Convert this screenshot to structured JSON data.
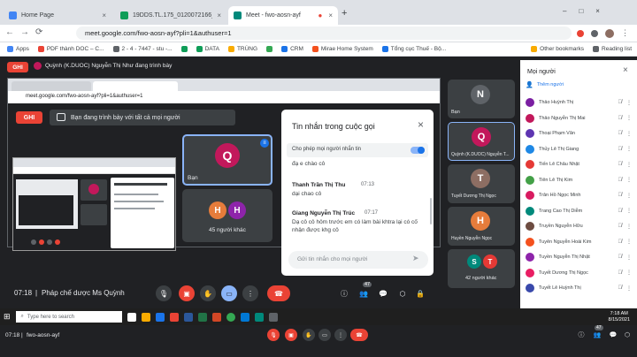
{
  "browser": {
    "tabs": [
      {
        "label": "Home Page",
        "color": "#4285f4"
      },
      {
        "label": "19DDS.TL.175_0120072166_0120...",
        "color": "#0f9d58"
      },
      {
        "label": "Meet - fwo-aosn-ayf",
        "color": "#00897b"
      }
    ],
    "url": "meet.google.com/fwo-aosn-ayf?pli=1&authuser=1",
    "bookmarks": [
      {
        "label": "Apps",
        "color": "#4285f4"
      },
      {
        "label": "PDF thành DOC – C...",
        "color": "#ea4335"
      },
      {
        "label": "2 - 4 - 7447 - stu -...",
        "color": "#5f6368"
      },
      {
        "label": "",
        "color": "#0f9d58"
      },
      {
        "label": "DATA",
        "color": "#0f9d58"
      },
      {
        "label": "TRÙNG",
        "color": "#f9ab00"
      },
      {
        "label": "",
        "color": "#34a853"
      },
      {
        "label": "CRM",
        "color": "#1a73e8"
      },
      {
        "label": "Mirae Home System",
        "color": "#f4511e"
      },
      {
        "label": "Tổng cục Thuế - Bộ...",
        "color": "#1a73e8"
      }
    ],
    "other_bookmarks": "Other bookmarks",
    "reading_list": "Reading list"
  },
  "meet": {
    "record_badge": "GHI",
    "presenter_line": "Quỳnh (K.DUOC) Nguyễn Thị Như đang trình bày",
    "inner_url": "meet.google.com/fwo-aosn-ayf?pli=1&authuser=1",
    "presenting_text": "Bạn đang trình bày với tất cả mọi người",
    "tiles": {
      "you_label": "Bạn",
      "you_initial": "Q",
      "others_label": "45 người khác",
      "others_initials": [
        "H",
        "H"
      ]
    },
    "clock": "07:18",
    "meeting_name": "Pháp chế dược Ms Quỳnh",
    "participants_count": "47",
    "chat_badge": "1"
  },
  "chat": {
    "title": "Tin nhắn trong cuộc gọi",
    "toggle_label": "Cho phép mọi người nhắn tin",
    "messages": [
      {
        "sender": "",
        "time": "",
        "text": "đạ e chào cô"
      },
      {
        "sender": "Thanh Trần Thị Thu",
        "time": "07:13",
        "text": "dại chao cô"
      },
      {
        "sender": "Giang Nguyễn Thị Trúc",
        "time": "07:17",
        "text": "Dạ cô cô hôm trước em có làm bài khtra lại có cố nhận được khg cô"
      }
    ],
    "input_placeholder": "Gửi tin nhắn cho mọi người"
  },
  "strip": [
    {
      "initial": "N",
      "name": "Bạn",
      "color": "#5f6368"
    },
    {
      "initial": "Q",
      "name": "Quỳnh (K.DUOC) Nguyễn T...",
      "color": "#c2185b"
    },
    {
      "initial": "T",
      "name": "Tuyết Dương Thị Ngọc",
      "color": "#8d6e63"
    },
    {
      "initial": "H",
      "name": "Huyền Nguyễn Ngọc",
      "color": "#e67c3b"
    },
    {
      "initial": "S",
      "name": "42 người khác",
      "color": "#00897b",
      "second": "T"
    }
  ],
  "people": {
    "title": "Mọi người",
    "add_label": "Thêm người",
    "list": [
      {
        "name": "Thảo Huỳnh Thị",
        "color": "#7b1fa2"
      },
      {
        "name": "Thảo Nguyễn Thị Mai",
        "color": "#c2185b"
      },
      {
        "name": "Thoại Phạm Văn",
        "color": "#5e35b1"
      },
      {
        "name": "Thủy Lê Thị Giang",
        "color": "#1e88e5"
      },
      {
        "name": "Tiến Lê Châu Nhật",
        "color": "#e53935"
      },
      {
        "name": "Tiên Lê Thị Kim",
        "color": "#43a047"
      },
      {
        "name": "Trân Hồ Ngọc Minh",
        "color": "#d81b60"
      },
      {
        "name": "Trang Cao Thị Diễm",
        "color": "#00897b"
      },
      {
        "name": "Truyền Nguyễn Hữu",
        "color": "#6d4c41"
      },
      {
        "name": "Tuyên Nguyễn Hoài Kim",
        "color": "#f4511e"
      },
      {
        "name": "Tuyền Nguyễn Thị Nhật",
        "color": "#8e24aa"
      },
      {
        "name": "Tuyết Dương Thị Ngọc",
        "color": "#e91e63"
      },
      {
        "name": "Tuyết Lê Huỳnh Thị",
        "color": "#3949ab"
      }
    ]
  },
  "taskbar": {
    "search": "Type here to search",
    "time": "7:18 AM",
    "date": "8/15/2021"
  },
  "outer_meet": {
    "clock": "07:18",
    "meeting_code": "fwo-aosn-ayf",
    "participants_count": "47"
  }
}
